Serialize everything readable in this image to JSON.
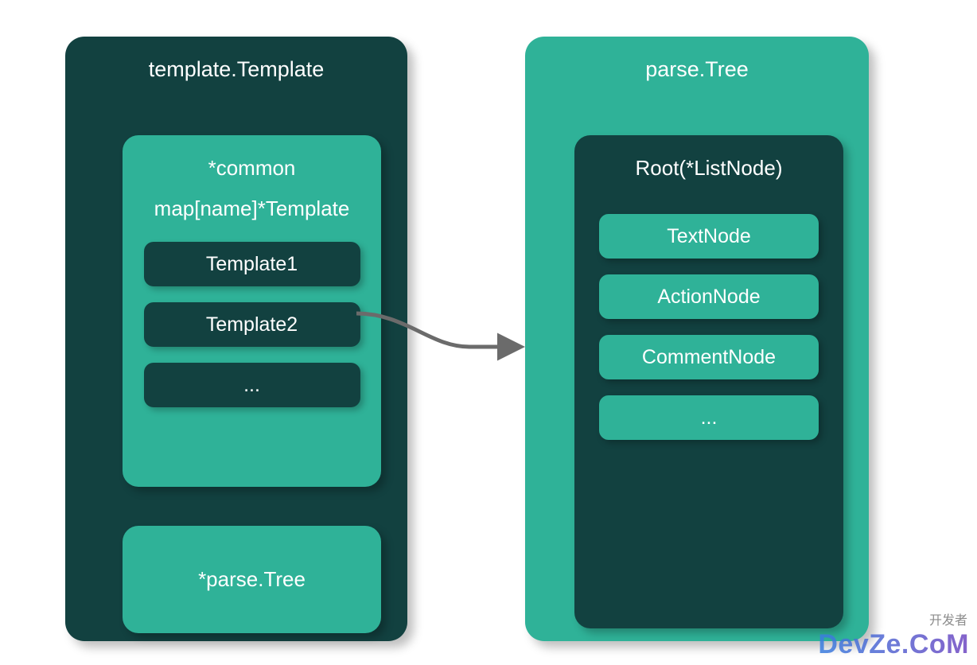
{
  "left": {
    "title": "template.Template",
    "common": {
      "header": "*common",
      "map_label": "map[name]*Template",
      "items": [
        "Template1",
        "Template2",
        "..."
      ]
    },
    "parse_tree": "*parse.Tree"
  },
  "right": {
    "title": "parse.Tree",
    "root": {
      "header": "Root(*ListNode)",
      "items": [
        "TextNode",
        "ActionNode",
        "CommentNode",
        "..."
      ]
    }
  },
  "watermark": {
    "cn": "开发者",
    "brand": "DevZe.CoM"
  },
  "colors": {
    "dark": "#124140",
    "teal": "#2FB298",
    "arrow": "#6b6b6b"
  }
}
